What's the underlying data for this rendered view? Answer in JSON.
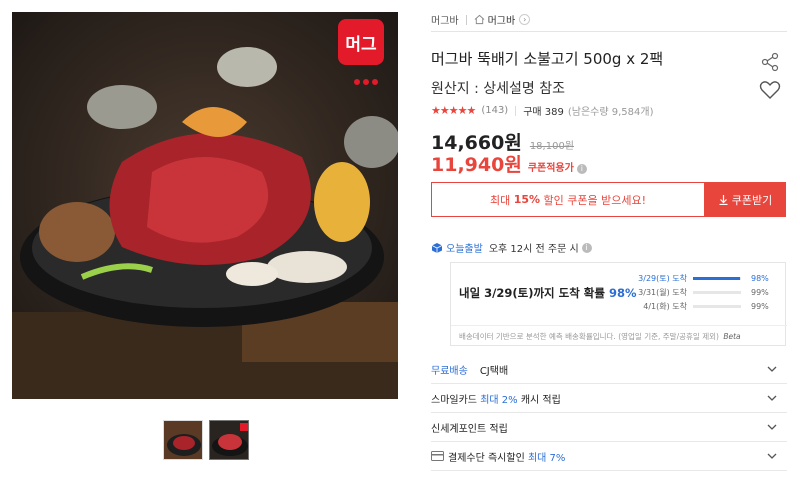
{
  "breadcrumb": {
    "brand": "머그바",
    "shop": "머그바"
  },
  "product": {
    "title": "머그바 뚝배기 소불고기 500g x 2팩",
    "origin": "원산지 : 상세설명 참조",
    "rating_stars": "★★★★★",
    "review_count": "(143)",
    "purchase": "구매 389",
    "remaining": "(남은수량 9,584개)",
    "price": "14,660원",
    "original_price": "18,100원",
    "coupon_price": "11,940원",
    "coupon_label": "쿠폰적용가"
  },
  "coupon": {
    "prefix": "최대",
    "percent": "15%",
    "suffix": "할인 쿠폰을 받으세요!",
    "button": "쿠폰받기"
  },
  "delivery": {
    "brand": "오늘출발",
    "cutoff": "오후 12시 전 주문 시",
    "headline_prefix": "내일 3/29(토)까지 도착 확률",
    "headline_pct": "98%",
    "probabilities": [
      {
        "label": "3/29(토) 도착",
        "value": "98%",
        "fill": 0.98
      },
      {
        "label": "3/31(월) 도착",
        "value": "99%",
        "fill": 0.99
      },
      {
        "label": "4/1(화) 도착",
        "value": "99%",
        "fill": 0.99
      }
    ],
    "note": "배송데이터 기반으로 분석한 예측 배송확률입니다. (영업일 기준, 주말/공휴일 제외)",
    "beta": "Beta"
  },
  "options": {
    "shipping_key": "무료배송",
    "shipping_val": "CJ택배",
    "smilecard_prefix": "스마일카드",
    "smilecard_pct": "최대 2%",
    "smilecard_suffix": "캐시 적립",
    "ssg_point": "신세계포인트 적립",
    "pay_prefix": "결제수단 즉시할인",
    "pay_pct": "최대 7%"
  },
  "colors": {
    "accent_red": "#e8453c",
    "accent_blue": "#2b6fd6"
  }
}
